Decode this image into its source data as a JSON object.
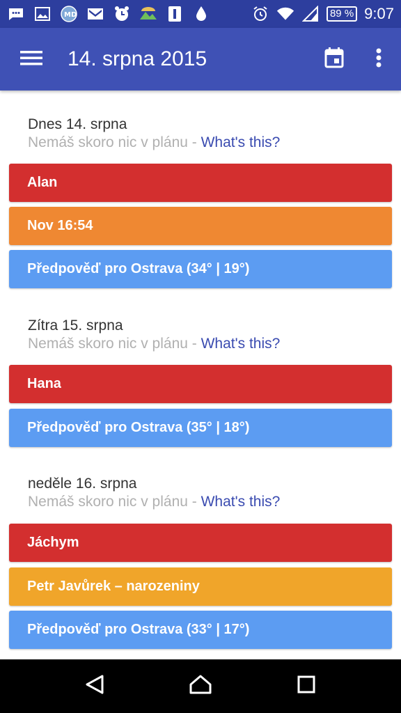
{
  "status_bar": {
    "battery_percent": "89 %",
    "time": "9:07",
    "icons": [
      "message-icon",
      "image-icon",
      "app-icon",
      "gmail-icon",
      "alarm-app-icon",
      "landscape-icon",
      "sim-icon",
      "water-drop-icon",
      "alarm-icon",
      "wifi-icon",
      "signal-icon",
      "battery-icon"
    ]
  },
  "app_bar": {
    "title": "14. srpna 2015",
    "icons": [
      "menu-icon",
      "calendar-today-icon",
      "more-vert-icon"
    ]
  },
  "days": [
    {
      "title": "Dnes 14. srpna",
      "sub": "Nemáš skoro nic v plánu - ",
      "link": "What's this?",
      "events": [
        {
          "label": "Alan",
          "color": "#d32f2f"
        },
        {
          "label": "Nov 16:54",
          "color": "#ef8832"
        },
        {
          "label": "Předpověď pro Ostrava (34° | 19°)",
          "color": "#5c9cf2"
        }
      ]
    },
    {
      "title": "Zítra 15. srpna",
      "sub": "Nemáš skoro nic v plánu - ",
      "link": "What's this?",
      "events": [
        {
          "label": "Hana",
          "color": "#d32f2f"
        },
        {
          "label": "Předpověď pro Ostrava (35° | 18°)",
          "color": "#5c9cf2"
        }
      ]
    },
    {
      "title": "neděle 16. srpna",
      "sub": "Nemáš skoro nic v plánu - ",
      "link": "What's this?",
      "events": [
        {
          "label": "Jáchym",
          "color": "#d32f2f"
        },
        {
          "label": "Petr Javůrek – narozeniny",
          "color": "#f0a52a"
        },
        {
          "label": "Předpověď pro Ostrava (33° | 17°)",
          "color": "#5c9cf2"
        }
      ]
    }
  ],
  "nav_bar": {
    "icons": [
      "back-icon",
      "home-icon",
      "recents-icon"
    ]
  }
}
